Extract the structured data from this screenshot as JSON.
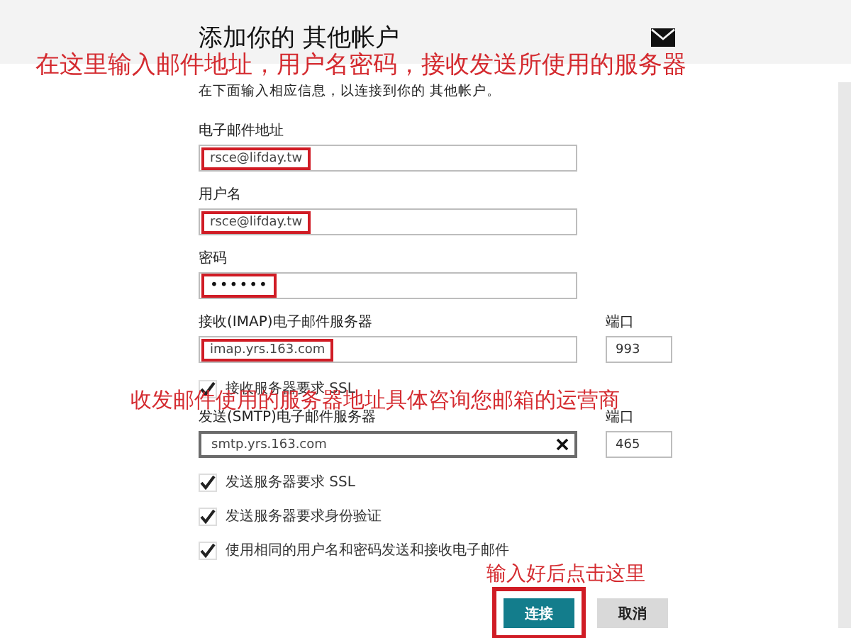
{
  "header": {
    "title": "添加你的 其他帐户"
  },
  "description": "在下面输入相应信息，以连接到你的 其他帐户。",
  "rows": [
    {
      "kind": "field",
      "label": "电子邮件地址",
      "value": "rsce@lifday.tw",
      "highlighted": true,
      "focused": false
    },
    {
      "kind": "field",
      "label": "用户名",
      "value": "rsce@lifday.tw",
      "highlighted": true,
      "focused": false
    },
    {
      "kind": "field",
      "label": "密码",
      "value": "••••••",
      "highlighted": true,
      "focused": false
    },
    {
      "kind": "server",
      "label": "接收(IMAP)电子邮件服务器",
      "value": "imap.yrs.163.com",
      "highlighted": true,
      "focused": false,
      "port_label": "端口",
      "port": "993"
    },
    {
      "kind": "checkbox",
      "label": "接收服务器要求 SSL",
      "checked": true
    },
    {
      "kind": "server",
      "label": "发送(SMTP)电子邮件服务器",
      "value": "smtp.yrs.163.com",
      "highlighted": false,
      "focused": true,
      "port_label": "端口",
      "port": "465"
    },
    {
      "kind": "checkbox",
      "label": "发送服务器要求 SSL",
      "checked": true
    },
    {
      "kind": "checkbox",
      "label": "发送服务器要求身份验证",
      "checked": true
    },
    {
      "kind": "checkbox",
      "label": "使用相同的用户名和密码发送和接收电子邮件",
      "checked": true
    }
  ],
  "buttons": [
    {
      "label": "连接",
      "kind": "primary",
      "highlighted": true
    },
    {
      "label": "取消",
      "kind": "secondary",
      "highlighted": false
    }
  ],
  "annotations": [
    {
      "text": "在这里输入邮件地址，用户名密码，接收发送所使用的服务器"
    },
    {
      "text": "收发邮件使用的服务器地址具体咨询您邮箱的运营商"
    },
    {
      "text": "输入好后点击这里"
    }
  ]
}
